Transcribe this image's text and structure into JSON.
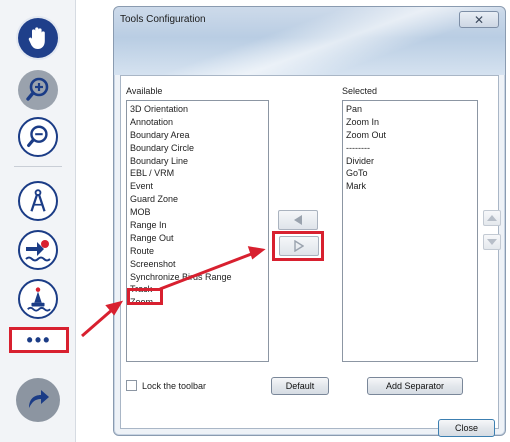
{
  "toolbar": {
    "buttons": [
      {
        "name": "pan-hand-icon",
        "style": "dark-blue"
      },
      {
        "name": "zoom-in-icon",
        "style": "grey"
      },
      {
        "name": "zoom-out-icon",
        "style": "white"
      },
      {
        "name": "divider-compass-icon",
        "style": "white"
      },
      {
        "name": "goto-icon",
        "style": "white"
      },
      {
        "name": "mark-buoy-icon",
        "style": "white"
      }
    ],
    "more_label": "•••",
    "route_button_icon": "curved-arrow-icon"
  },
  "dialog": {
    "title": "Tools Configuration",
    "close_glyph": "✕",
    "available_label": "Available",
    "selected_label": "Selected",
    "available": [
      "3D Orientation",
      "Annotation",
      "Boundary Area",
      "Boundary Circle",
      "Boundary Line",
      "EBL / VRM",
      "Event",
      "Guard Zone",
      "MOB",
      "Range In",
      "Range Out",
      "Route",
      "Screenshot",
      "Synchronize Birds Range",
      "Track",
      "Zoom"
    ],
    "selected": [
      "Pan",
      "Zoom In",
      "Zoom Out",
      "--------",
      "Divider",
      "GoTo",
      "Mark"
    ],
    "lock_label": "Lock the toolbar",
    "default_label": "Default",
    "add_separator_label": "Add Separator",
    "close_label": "Close"
  },
  "colors": {
    "highlight_red": "#d8202f",
    "toolbar_blue": "#1b3c86"
  }
}
